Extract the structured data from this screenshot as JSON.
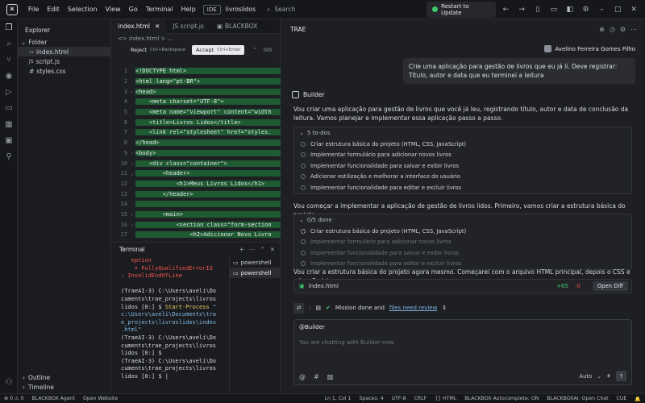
{
  "titlebar": {
    "menu": [
      "File",
      "Edit",
      "Selection",
      "View",
      "Go",
      "Terminal",
      "Help"
    ],
    "ide_badge": "IDE",
    "workspace": "livroslidos",
    "search_placeholder": "Search",
    "restart_label": "Restart to Update"
  },
  "explorer": {
    "title": "Explorer",
    "folder": "Folder",
    "files": [
      "index.html",
      "script.js",
      "styles.css"
    ],
    "selected": "index.html",
    "outline": "Outline",
    "timeline": "Timeline"
  },
  "editor": {
    "tabs": [
      {
        "label": "index.html",
        "active": true
      },
      {
        "label": "JS script.js",
        "active": false
      },
      {
        "label": "BLACKBOX",
        "active": false
      }
    ],
    "breadcrumb": "<> index.html > ...",
    "reject_label": "Reject",
    "reject_kbd": "Ctrl+Backspace",
    "accept_label": "Accept",
    "accept_kbd": "Ctrl+Enter",
    "diff_counter": "0/0",
    "lines": [
      {
        "n": "1",
        "html": "<span class='tag'>&lt;!DOCTYPE html&gt;</span>",
        "added": true,
        "fold": ""
      },
      {
        "n": "2",
        "html": "<span class='tag'>&lt;html</span> <span class='attr'>lang=\"pt-BR\"</span>&gt;",
        "added": true,
        "fold": ""
      },
      {
        "n": "3",
        "html": "&lt;head&gt;",
        "added": true,
        "fold": "⌄"
      },
      {
        "n": "4",
        "html": "    &lt;meta charset=\"UTF-8\"&gt;",
        "added": true,
        "fold": ""
      },
      {
        "n": "5",
        "html": "    &lt;meta name=\"viewport\" content=\"width",
        "added": true,
        "fold": ""
      },
      {
        "n": "6",
        "html": "    &lt;title&gt;Livros Lidos&lt;/title&gt;",
        "added": true,
        "fold": ""
      },
      {
        "n": "7",
        "html": "    &lt;link rel=\"stylesheet\" href=\"styles.",
        "added": true,
        "fold": ""
      },
      {
        "n": "8",
        "html": "&lt;/head&gt;",
        "added": true,
        "fold": ""
      },
      {
        "n": "9",
        "html": "&lt;body&gt;",
        "added": true,
        "fold": "⌄"
      },
      {
        "n": "10",
        "html": "    &lt;div class=\"container\"&gt;",
        "added": true,
        "fold": "⌄"
      },
      {
        "n": "11",
        "html": "        &lt;header&gt;",
        "added": true,
        "fold": "⌄"
      },
      {
        "n": "12",
        "html": "            &lt;h1&gt;Meus Livros Lidos&lt;/h1&gt;",
        "added": true,
        "fold": ""
      },
      {
        "n": "13",
        "html": "        &lt;/header&gt;",
        "added": true,
        "fold": ""
      },
      {
        "n": "14",
        "html": "",
        "added": true,
        "fold": ""
      },
      {
        "n": "15",
        "html": "        &lt;main&gt;",
        "added": true,
        "fold": "⌄"
      },
      {
        "n": "16",
        "html": "            &lt;section class=\"form-section",
        "added": true,
        "fold": "⌄"
      },
      {
        "n": "17",
        "html": "                &lt;h2&gt;Adicionar Novo Livro",
        "added": true,
        "fold": ""
      },
      {
        "n": "18",
        "html": "                &lt;form id=\"livro-form\"&gt;",
        "added": true,
        "fold": ""
      }
    ]
  },
  "terminal": {
    "title": "Terminal",
    "sessions": [
      "powershell",
      "powershell"
    ],
    "selected_session": 1,
    "lines": [
      {
        "cls": "err",
        "text": "   eption"
      },
      {
        "cls": "err",
        "text": "    + FullyQualifiedErrorId"
      },
      {
        "cls": "err",
        "text": ": InvalidEndOfLine"
      },
      {
        "cls": "",
        "text": ""
      },
      {
        "cls": "",
        "text": "(TraeAI-3) C:\\Users\\aveli\\Do"
      },
      {
        "cls": "",
        "text": "cuments\\trae_projects\\livros"
      },
      {
        "cls": "mix",
        "text": "lidos [0:] $ ",
        "cmd": "Start-Process",
        "tail": " \""
      },
      {
        "cls": "path",
        "text": "c:\\Users\\aveli\\Documents\\tra"
      },
      {
        "cls": "path",
        "text": "e_projects\\livroslidos\\index"
      },
      {
        "cls": "path",
        "text": ".html\""
      },
      {
        "cls": "",
        "text": "(TraeAI-3) C:\\Users\\aveli\\Do"
      },
      {
        "cls": "",
        "text": "cuments\\trae_projects\\livros"
      },
      {
        "cls": "",
        "text": "lidos [0:] $"
      },
      {
        "cls": "",
        "text": "(TraeAI-3) C:\\Users\\aveli\\Do"
      },
      {
        "cls": "",
        "text": "cuments\\trae_projects\\livros"
      },
      {
        "cls": "",
        "text": "lidos [0:] $ |"
      }
    ]
  },
  "chat": {
    "title": "TRAE",
    "user_name": "Avelino Ferreira Gomes Filho",
    "user_message": "Crie uma aplicação para gestão de livros que eu já li. Deve registrar: Título, autor e data que eu terminei a leitura",
    "agent_name": "Builder",
    "intro": "Vou criar uma aplicação para gestão de livros que você já leu, registrando título, autor e data de conclusão da leitura. Vamos planejar e implementar essa aplicação passo a passo.",
    "todo1_head": "5 to-dos",
    "todos": [
      "Criar estrutura básica do projeto (HTML, CSS, JavaScript)",
      "Implementar formulário para adicionar novos livros",
      "Implementar funcionalidade para salvar e exibir livros",
      "Adicionar estilização e melhorar a interface do usuário",
      "Implementar funcionalidade para editar e excluir livros"
    ],
    "mid_text": "Vou começar a implementar a aplicação de gestão de livros lidos. Primeiro, vamos criar a estrutura básica do projeto.",
    "todo2_head": "0/5 done",
    "todos2": [
      {
        "text": "Criar estrutura básica do projeto (HTML, CSS, JavaScript)",
        "state": "active"
      },
      {
        "text": "Implementar formulário para adicionar novos livros",
        "state": "dim"
      },
      {
        "text": "Implementar funcionalidade para salvar e exibir livros",
        "state": "dim"
      },
      {
        "text": "Implementar funcionalidade para editar e excluir livros",
        "state": "dim"
      }
    ],
    "create_text": "Vou criar a estrutura básica do projeto agora mesmo. Começarei com o arquivo HTML principal, depois o CSS e o JavaScript.",
    "file_card": {
      "name": "index.html",
      "added": "+65",
      "removed": "-0",
      "open_label": "Open Diff"
    },
    "mission_text": "Mission done and",
    "mission_link": "files need review",
    "input_tag": "@Builder",
    "input_placeholder": "You are chatting with Builder now",
    "model": "Auto"
  },
  "status": {
    "left": [
      "⊗ 0 ⚠ 0",
      "BLACKBOX Agent",
      "Open Website"
    ],
    "right": [
      "Ln 1, Col 1",
      "Spaces: 4",
      "UTF-8",
      "CRLF",
      "{} HTML",
      "BLACKBOX Autocomplete: ON",
      "BLACKBOXAI: Open Chat",
      "CUE"
    ]
  }
}
